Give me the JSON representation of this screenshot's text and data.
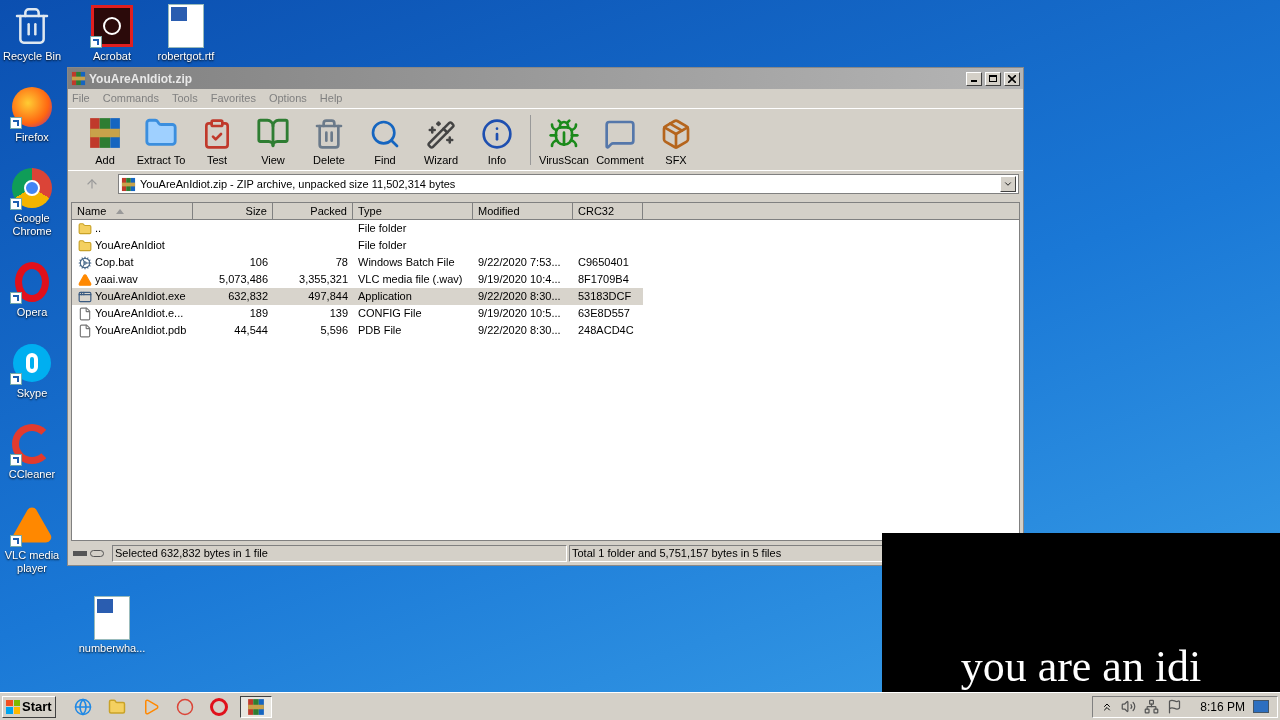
{
  "desktop_icons": [
    {
      "label": "Recycle Bin",
      "kind": "recycle",
      "shortcut": false
    },
    {
      "label": "Firefox",
      "kind": "firefox",
      "shortcut": true
    },
    {
      "label": "Google Chrome",
      "kind": "chrome",
      "shortcut": true
    },
    {
      "label": "Opera",
      "kind": "opera",
      "shortcut": true
    },
    {
      "label": "Skype",
      "kind": "skype",
      "shortcut": true
    },
    {
      "label": "CCleaner",
      "kind": "ccleaner",
      "shortcut": true
    },
    {
      "label": "VLC media player",
      "kind": "vlc",
      "shortcut": true
    }
  ],
  "desktop_icons_extra": [
    {
      "label": "Acrobat",
      "kind": "acrobat",
      "shortcut": true
    },
    {
      "label": "robertgot.rtf",
      "kind": "word",
      "shortcut": false
    },
    {
      "label": "numberwha...",
      "kind": "word",
      "shortcut": false
    }
  ],
  "window": {
    "title": "YouAreAnIdiot.zip",
    "menu": [
      "File",
      "Commands",
      "Tools",
      "Favorites",
      "Options",
      "Help"
    ],
    "toolbar": [
      {
        "label": "Add"
      },
      {
        "label": "Extract To"
      },
      {
        "label": "Test"
      },
      {
        "label": "View"
      },
      {
        "label": "Delete"
      },
      {
        "label": "Find"
      },
      {
        "label": "Wizard"
      },
      {
        "label": "Info"
      },
      {
        "label": "VirusScan"
      },
      {
        "label": "Comment"
      },
      {
        "label": "SFX"
      }
    ],
    "address": "YouAreAnIdiot.zip - ZIP archive, unpacked size 11,502,314 bytes",
    "columns": [
      "Name",
      "Size",
      "Packed",
      "Type",
      "Modified",
      "CRC32"
    ],
    "rows": [
      {
        "kind": "folder",
        "selected": false,
        "cells": [
          "..",
          "",
          "",
          "File folder",
          "",
          ""
        ]
      },
      {
        "kind": "folder",
        "selected": false,
        "cells": [
          "YouAreAnIdiot",
          "",
          "",
          "File folder",
          "",
          ""
        ]
      },
      {
        "kind": "batch",
        "selected": false,
        "cells": [
          "Cop.bat",
          "106",
          "78",
          "Windows Batch File",
          "9/22/2020 7:53...",
          "C9650401"
        ]
      },
      {
        "kind": "media",
        "selected": false,
        "cells": [
          "yaai.wav",
          "5,073,486",
          "3,355,321",
          "VLC media file (.wav)",
          "9/19/2020 10:4...",
          "8F1709B4"
        ]
      },
      {
        "kind": "app",
        "selected": true,
        "cells": [
          "YouAreAnIdiot.exe",
          "632,832",
          "497,844",
          "Application",
          "9/22/2020 8:30...",
          "53183DCF"
        ]
      },
      {
        "kind": "file",
        "selected": false,
        "cells": [
          "YouAreAnIdiot.e...",
          "189",
          "139",
          "CONFIG File",
          "9/19/2020 10:5...",
          "63E8D557"
        ]
      },
      {
        "kind": "file",
        "selected": false,
        "cells": [
          "YouAreAnIdiot.pdb",
          "44,544",
          "5,596",
          "PDB File",
          "9/22/2020 8:30...",
          "248ACD4C"
        ]
      }
    ],
    "status_left": "Selected 632,832 bytes in 1 file",
    "status_right": "Total 1 folder and 5,751,157 bytes in 5 files"
  },
  "popup": {
    "text": "you are an idi"
  },
  "taskbar": {
    "start": "Start",
    "clock": "8:16 PM",
    "apps": [
      {
        "kind": "ie",
        "selected": false
      },
      {
        "kind": "explorer",
        "selected": false
      },
      {
        "kind": "media",
        "selected": false
      },
      {
        "kind": "chrome",
        "selected": false
      },
      {
        "kind": "opera",
        "selected": false
      },
      {
        "kind": "winrar",
        "selected": true
      }
    ]
  }
}
